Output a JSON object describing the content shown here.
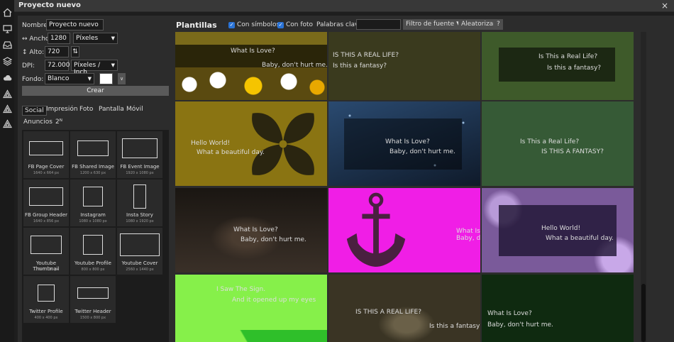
{
  "dialog": {
    "title": "Proyecto nuevo",
    "close": "×"
  },
  "rail_icons": [
    "home-icon",
    "monitor-icon",
    "inbox-icon",
    "layers-icon",
    "cloud-icon",
    "triangle-icon",
    "triangle-icon",
    "triangle-icon"
  ],
  "form": {
    "name_label": "Nombre:",
    "name_value": "Proyecto nuevo",
    "width_label": "↔ Ancho:",
    "width_value": "1280",
    "width_unit": "Píxeles",
    "height_label": "↕ Alto:",
    "height_value": "720",
    "swap": "⇅",
    "dpi_label": "DPI:",
    "dpi_value": "72.000",
    "dpi_unit": "Píxeles / Inch",
    "bg_label": "Fondo:",
    "bg_value": "Blanco",
    "bg_color": "#ffffff",
    "create": "Crear"
  },
  "preset_tabs": [
    "Social",
    "Impresión",
    "Foto",
    "Pantalla",
    "Móvil",
    "Anuncios",
    "2ᴺ"
  ],
  "presets": [
    {
      "name": "FB Page Cover",
      "dims": "1640 x 664 px"
    },
    {
      "name": "FB Shared Image",
      "dims": "1200 x 630 px"
    },
    {
      "name": "FB Event Image",
      "dims": "1920 x 1080 px"
    },
    {
      "name": "FB Group Header",
      "dims": "1640 x 856 px"
    },
    {
      "name": "Instagram",
      "dims": "1080 x 1080 px"
    },
    {
      "name": "Insta Story",
      "dims": "1080 x 1920 px"
    },
    {
      "name": "Youtube Thumbnail",
      "dims": "1280 x 720 px"
    },
    {
      "name": "Youtube Profile",
      "dims": "800 x 800 px"
    },
    {
      "name": "Youtube Cover",
      "dims": "2560 x 1440 px"
    },
    {
      "name": "Twitter Profile",
      "dims": "400 x 400 px"
    },
    {
      "name": "Twitter Header",
      "dims": "1500 x 800 px"
    }
  ],
  "templates": {
    "title": "Plantillas",
    "with_symbols": "Con símbolos",
    "with_photo": "Con foto",
    "keywords_label": "Palabras clave:",
    "font_filter": "Filtro de fuente ▼",
    "randomize": "Aleatorizar",
    "help": "?",
    "items": [
      {
        "title": "What Is Love?",
        "subtitle": "Baby, don't hurt me.",
        "bg": "#7a6a1a"
      },
      {
        "title": "IS THIS A REAL LIFE?",
        "subtitle": "Is this a fantasy?",
        "bg": "#3a3a1e"
      },
      {
        "title": "Is This a Real Life?",
        "subtitle": "Is this a fantasy?",
        "bg": "#3e5a2a"
      },
      {
        "title": "Hello World!",
        "subtitle": "What a beautiful day.",
        "bg": "#8a7412"
      },
      {
        "title": "What Is Love?",
        "subtitle": "Baby, don't hurt me.",
        "bg": "#1b2a40"
      },
      {
        "title": "Is This a Real Life?",
        "subtitle": "IS THIS A FANTASY?",
        "bg": "#365a36"
      },
      {
        "title": "What Is Love?",
        "subtitle": "Baby, don't hurt me.",
        "bg": "#2a241e"
      },
      {
        "title": "What Is Love?",
        "subtitle": "Baby, don't hurt me.",
        "bg": "#f01ee6"
      },
      {
        "title": "Hello World!",
        "subtitle": "What a beautiful day.",
        "bg": "#7a5a9a"
      },
      {
        "title": "I Saw The Sign.",
        "subtitle": "And it opened up my eyes",
        "bg": "#86f04a"
      },
      {
        "title": "IS THIS A REAL LIFE?",
        "subtitle": "Is this a fantasy?",
        "bg": "#4a4230"
      },
      {
        "title": "What Is Love?",
        "subtitle": "Baby, don't hurt me.",
        "bg": "#0f2a10"
      }
    ]
  }
}
